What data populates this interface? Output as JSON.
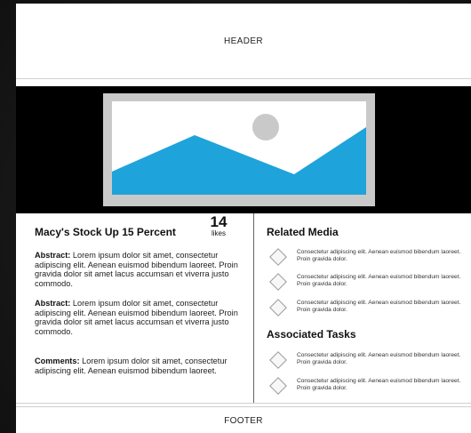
{
  "header": {
    "label": "HEADER"
  },
  "hero": {
    "image": "landscape-image-placeholder"
  },
  "article": {
    "title": "Macy's Stock Up 15 Percent",
    "likes_count": "14",
    "likes_label": "likes",
    "abstract_1_label": "Abstract:",
    "abstract_1_text": "Lorem ipsum dolor sit amet, consectetur adipiscing elit. Aenean euismod bibendum laoreet. Proin gravida dolor sit amet lacus accumsan et viverra justo commodo.",
    "abstract_2_label": "Abstract:",
    "abstract_2_text": "Lorem ipsum dolor sit amet, consectetur adipiscing elit. Aenean euismod bibendum laoreet. Proin gravida dolor sit amet lacus accumsan et viverra justo commodo.",
    "comments_label": "Comments:",
    "comments_text": "Lorem ipsum dolor sit amet, consectetur adipiscing elit. Aenean euismod bibendum laoreet."
  },
  "related_media": {
    "title": "Related Media",
    "items": [
      {
        "text": "Consectetur adipiscing elit. Aenean euismod bibendum laoreet. Proin gravida dolor."
      },
      {
        "text": "Consectetur adipiscing elit. Aenean euismod bibendum laoreet. Proin gravida dolor."
      },
      {
        "text": "Consectetur adipiscing elit. Aenean euismod bibendum laoreet. Proin gravida dolor."
      }
    ]
  },
  "associated_tasks": {
    "title": "Associated Tasks",
    "items": [
      {
        "text": "Consectetur adipiscing elit. Aenean euismod bibendum laoreet. Proin gravida dolor."
      },
      {
        "text": "Consectetur adipiscing elit. Aenean euismod bibendum laoreet. Proin gravida dolor."
      }
    ]
  },
  "footer": {
    "label": "FOOTER"
  },
  "colors": {
    "hero_background": "#000000",
    "mountain": "#1fa3db",
    "sun": "#c9c9c9"
  }
}
